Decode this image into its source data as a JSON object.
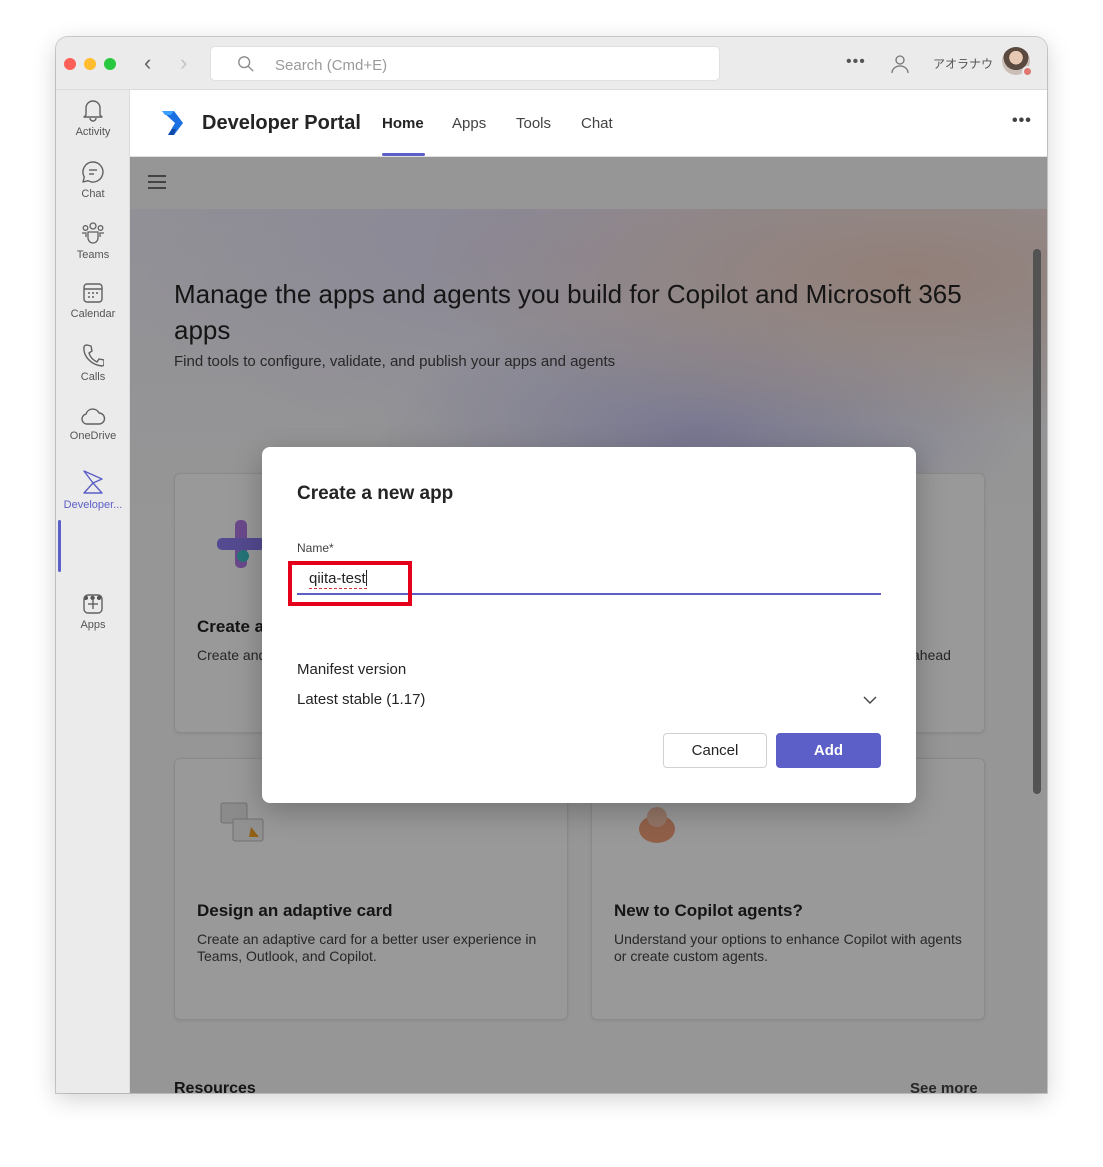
{
  "window": {
    "search_placeholder": "Search (Cmd+E)",
    "more_label": "•••",
    "user_name": "アオラナウ"
  },
  "rail": {
    "items": [
      {
        "label": "Activity",
        "icon": "bell-icon"
      },
      {
        "label": "Chat",
        "icon": "chat-icon"
      },
      {
        "label": "Teams",
        "icon": "teams-icon"
      },
      {
        "label": "Calendar",
        "icon": "calendar-icon"
      },
      {
        "label": "Calls",
        "icon": "phone-icon"
      },
      {
        "label": "OneDrive",
        "icon": "cloud-icon"
      },
      {
        "label": "Developer...",
        "icon": "developer-portal-icon"
      },
      {
        "label": "Apps",
        "icon": "add-app-icon"
      }
    ],
    "more_label": "•••",
    "active_color": "#5b5fc7"
  },
  "header": {
    "title": "Developer Portal",
    "tabs": [
      {
        "label": "Home",
        "active": true
      },
      {
        "label": "Apps",
        "active": false
      },
      {
        "label": "Tools",
        "active": false
      },
      {
        "label": "Chat",
        "active": false
      }
    ],
    "more_label": "•••"
  },
  "main": {
    "hero_title": "Manage the apps and agents you build for Copilot and Microsoft 365 apps",
    "hero_subtitle": "Find tools to configure, validate, and publish your apps and agents",
    "cards": [
      {
        "title": "Create a",
        "desc": "Create and"
      },
      {
        "title": "",
        "desc": "ahead"
      },
      {
        "title": "Design an adaptive card",
        "desc": "Create an adaptive card for a better user experience in Teams, Outlook, and Copilot."
      },
      {
        "title": "New to Copilot agents?",
        "desc": "Understand your options to enhance Copilot with agents or create custom agents."
      }
    ],
    "resources_label": "Resources",
    "see_more_label": "See more"
  },
  "dialog": {
    "title": "Create a new app",
    "name_label": "Name*",
    "name_value": "qiita-test",
    "manifest_label": "Manifest version",
    "manifest_value": "Latest stable (1.17)",
    "cancel_label": "Cancel",
    "add_label": "Add",
    "accent_color": "#5b5fc7",
    "highlight_color": "#e4001b"
  }
}
